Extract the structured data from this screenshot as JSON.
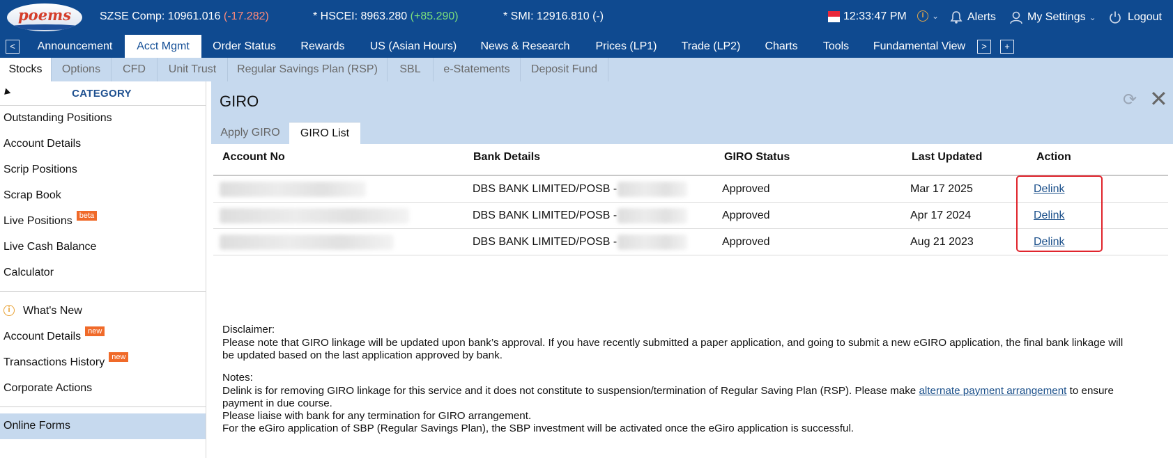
{
  "topbar": {
    "logo_text": "poems",
    "tickers": [
      {
        "label": "SZSE Comp: 10961.016",
        "change": "(-17.282)",
        "dir": "neg"
      },
      {
        "label": "* HSCEI: 8963.280",
        "change": "(+85.290)",
        "dir": "pos"
      },
      {
        "label": "* SMI: 12916.810",
        "change": "(-)",
        "dir": "none"
      }
    ],
    "time": "12:33:47 PM",
    "alerts_label": "Alerts",
    "settings_label": "My Settings",
    "logout_label": "Logout"
  },
  "nav": {
    "tabs": [
      "Announcement",
      "Acct Mgmt",
      "Order Status",
      "Rewards",
      "US (Asian Hours)",
      "News & Research",
      "Prices (LP1)",
      "Trade (LP2)",
      "Charts",
      "Tools",
      "Fundamental View"
    ],
    "active": "Acct Mgmt",
    "prev_glyph": "<",
    "next_glyph": ">",
    "add_glyph": "+"
  },
  "subnav": {
    "tabs": [
      "Stocks",
      "Options",
      "CFD",
      "Unit Trust",
      "Regular Savings Plan (RSP)",
      "SBL",
      "e-Statements",
      "Deposit Fund"
    ],
    "active": "Stocks"
  },
  "sidebar": {
    "category_label": "CATEGORY",
    "group1": [
      "Outstanding Positions",
      "Account Details",
      "Scrip Positions",
      "Scrap Book",
      "Live Positions",
      "Live Cash Balance",
      "Calculator"
    ],
    "live_positions_badge": "beta",
    "group2": [
      "What's New",
      "Account Details",
      "Transactions History",
      "Corporate Actions"
    ],
    "new_badge": "new",
    "group3": [
      "Online Forms"
    ],
    "active": "Online Forms"
  },
  "panel": {
    "title": "GIRO",
    "tabs": [
      "Apply GIRO",
      "GIRO List"
    ],
    "active_tab": "GIRO List"
  },
  "table": {
    "headers": [
      "Account No",
      "Bank Details",
      "GIRO Status",
      "Last Updated",
      "Action"
    ],
    "rows": [
      {
        "bank": "DBS BANK LIMITED/POSB -",
        "status": "Approved",
        "updated": "Mar 17 2025",
        "action": "Delink"
      },
      {
        "bank": "DBS BANK LIMITED/POSB -",
        "status": "Approved",
        "updated": "Apr 17 2024",
        "action": "Delink"
      },
      {
        "bank": "DBS BANK LIMITED/POSB -",
        "status": "Approved",
        "updated": "Aug 21 2023",
        "action": "Delink"
      }
    ]
  },
  "disclaimer": {
    "heading": "Disclaimer:",
    "line1": "Please note that GIRO linkage will be updated upon bank’s approval. If you have recently submitted a paper application, and going to submit a new eGIRO application, the final bank linkage will",
    "line2": "be updated based on the last application approved by bank."
  },
  "notes": {
    "heading": "Notes:",
    "line1_before": "Delink is for removing GIRO linkage for this service and it does not constitute to suspension/termination of Regular Saving Plan (RSP). Please make ",
    "line1_link": "alternate payment arrangement",
    "line1_after": " to ensure",
    "line2": "payment in due course.",
    "line3": "Please liaise with bank for any termination for GIRO arrangement.",
    "line4": "For the eGiro application of SBP (Regular Savings Plan), the SBP investment will be activated once the eGiro application is successful."
  }
}
